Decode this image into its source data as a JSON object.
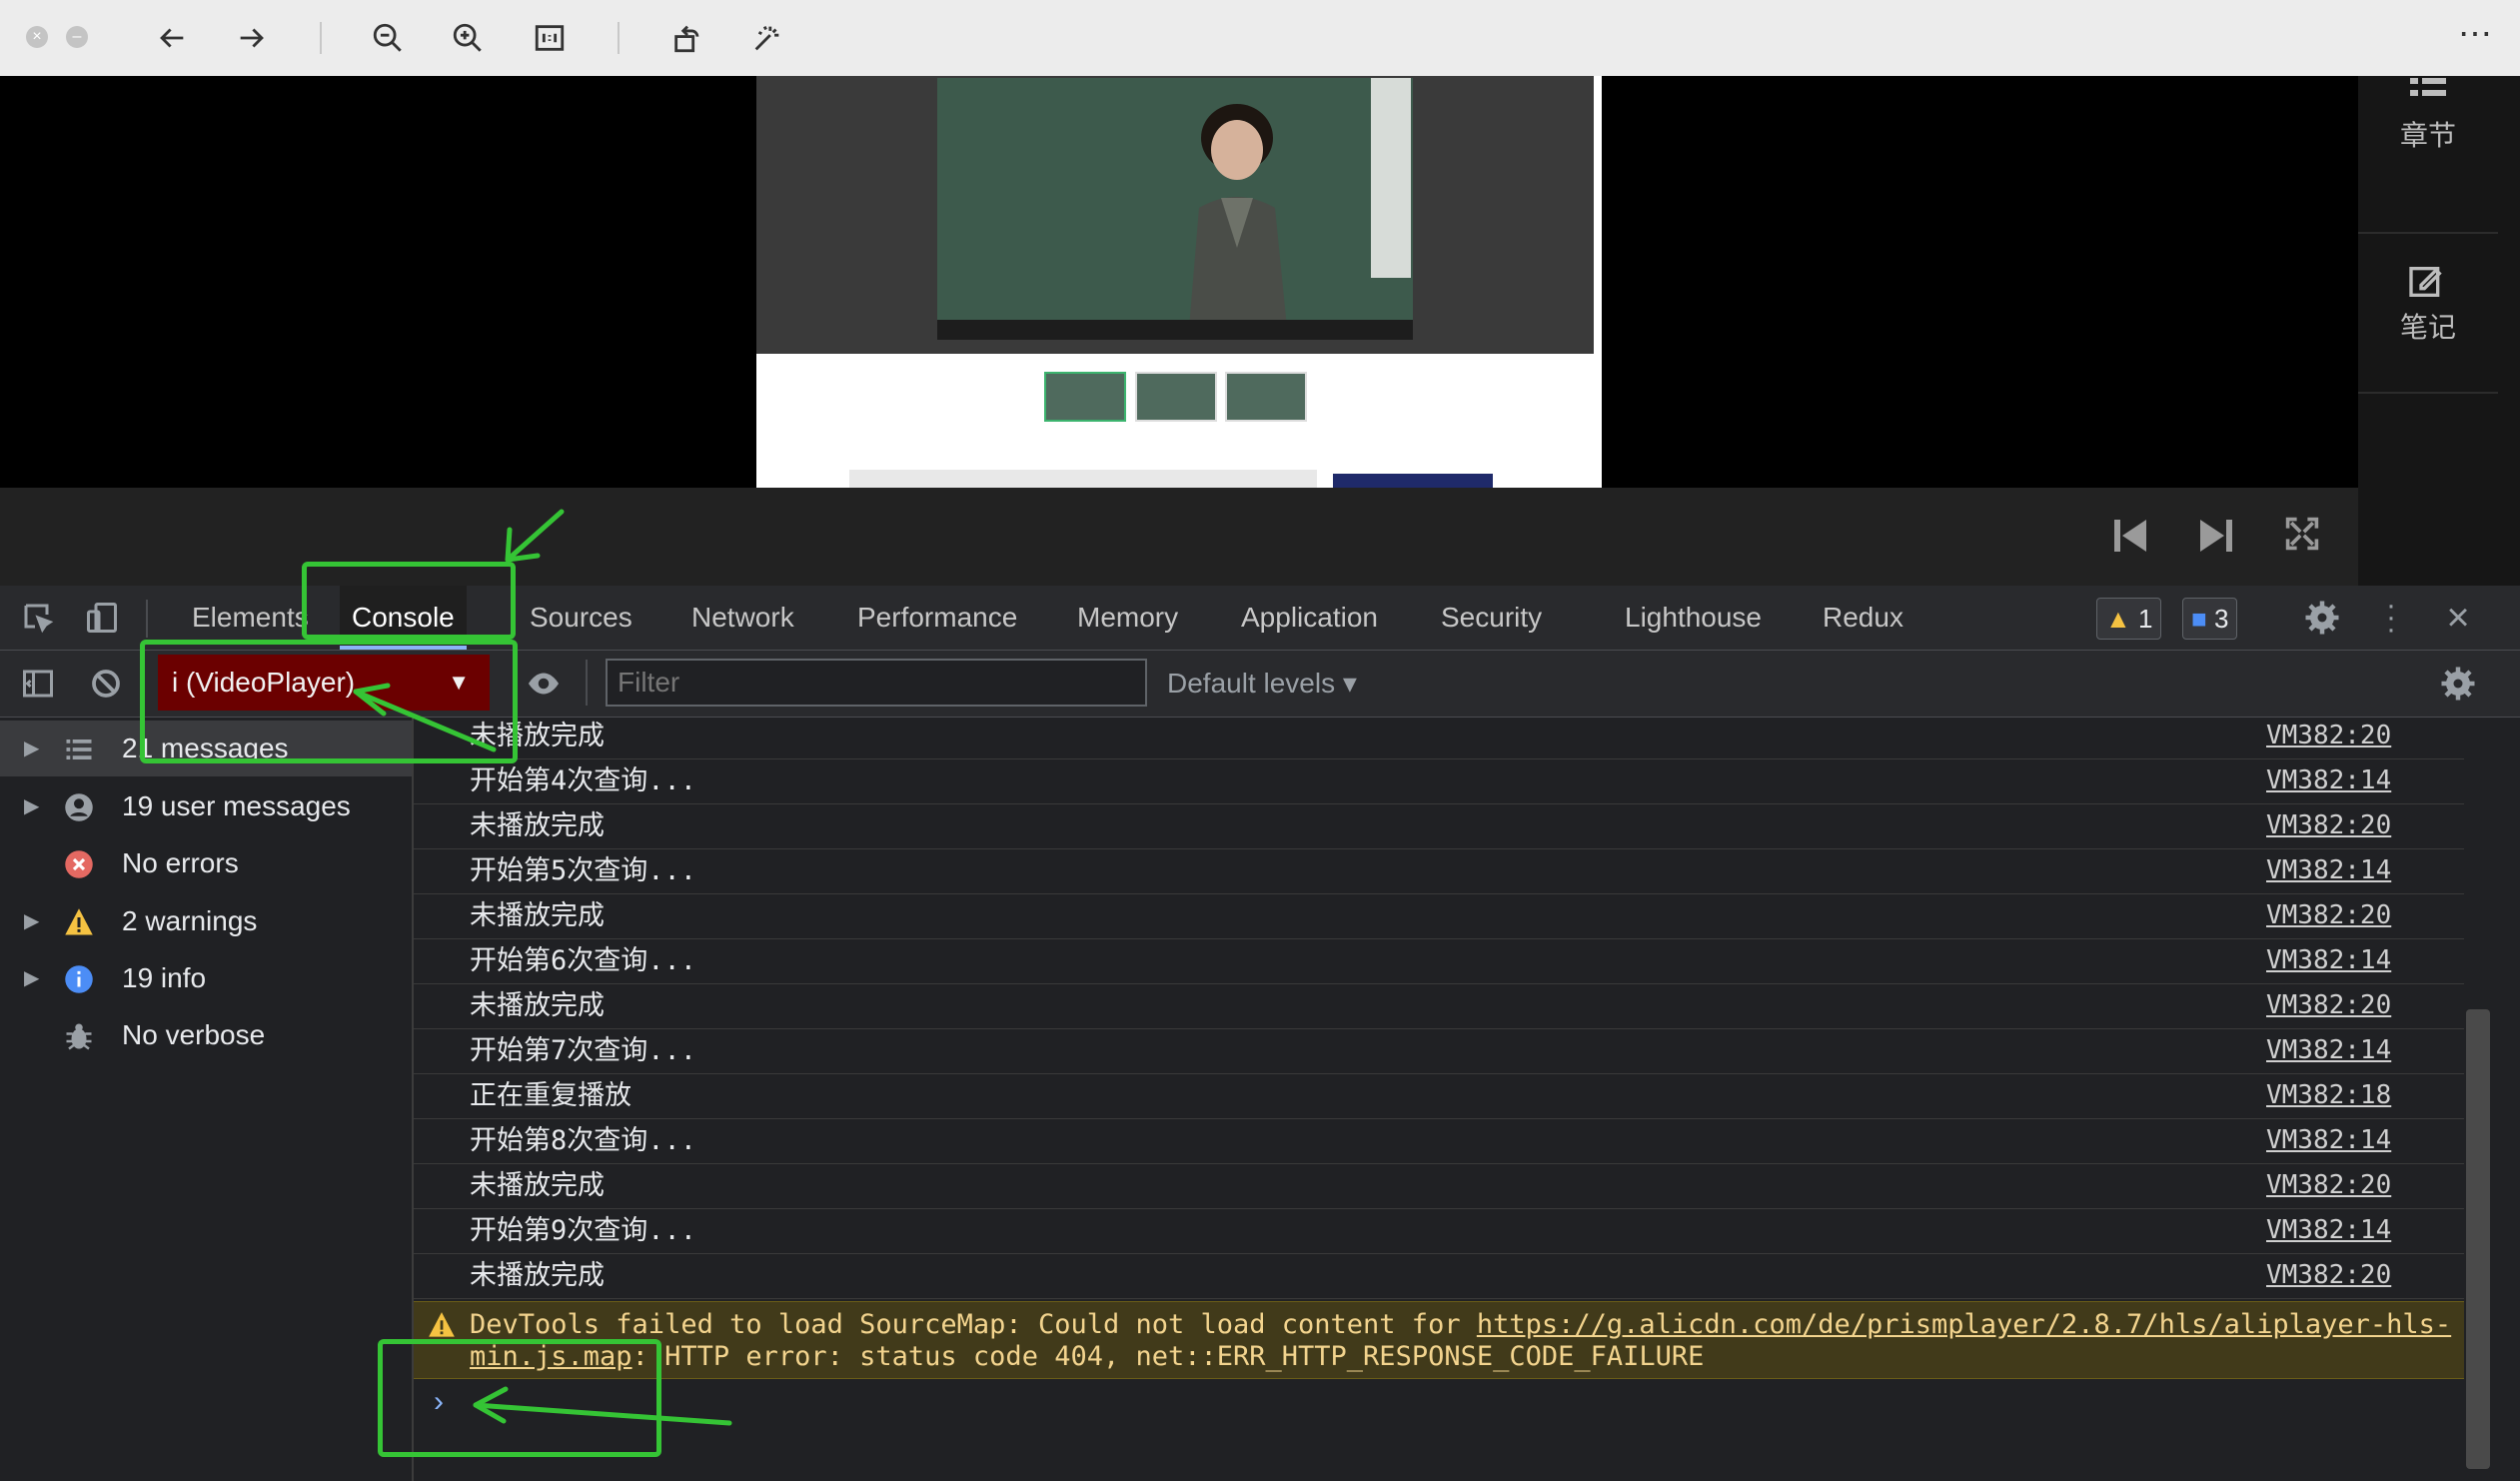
{
  "viewer_toolbar": {
    "more_label": "⋯"
  },
  "right_panel": {
    "chapters_label": "章节",
    "notes_label": "笔记"
  },
  "devtools": {
    "tabs": [
      "Elements",
      "Console",
      "Sources",
      "Network",
      "Performance",
      "Memory",
      "Application",
      "Security",
      "Lighthouse",
      "Redux"
    ],
    "active_tab": "Console",
    "warning_count": "1",
    "info_count": "3"
  },
  "console_toolbar": {
    "context": "i (VideoPlayer)",
    "filter_placeholder": "Filter",
    "levels": "Default levels ▾"
  },
  "sidebar": {
    "items": [
      {
        "label": "21 messages",
        "icon": "list-icon"
      },
      {
        "label": "19 user messages",
        "icon": "user-icon"
      },
      {
        "label": "No errors",
        "icon": "error-icon"
      },
      {
        "label": "2 warnings",
        "icon": "warning-icon"
      },
      {
        "label": "19 info",
        "icon": "info-icon"
      },
      {
        "label": "No verbose",
        "icon": "bug-icon"
      }
    ]
  },
  "logs": [
    {
      "message": "未播放完成",
      "source": "VM382:20"
    },
    {
      "message": "开始第4次查询...",
      "source": "VM382:14"
    },
    {
      "message": "未播放完成",
      "source": "VM382:20"
    },
    {
      "message": "开始第5次查询...",
      "source": "VM382:14"
    },
    {
      "message": "未播放完成",
      "source": "VM382:20"
    },
    {
      "message": "开始第6次查询...",
      "source": "VM382:14"
    },
    {
      "message": "未播放完成",
      "source": "VM382:20"
    },
    {
      "message": "开始第7次查询...",
      "source": "VM382:14"
    },
    {
      "message": "正在重复播放",
      "source": "VM382:18"
    },
    {
      "message": "开始第8次查询...",
      "source": "VM382:14"
    },
    {
      "message": "未播放完成",
      "source": "VM382:20"
    },
    {
      "message": "开始第9次查询...",
      "source": "VM382:14"
    },
    {
      "message": "未播放完成",
      "source": "VM382:20"
    }
  ],
  "warning": {
    "prefix": "DevTools failed to load SourceMap: Could not load content for ",
    "link_part1": "https://g.alicdn.com/de/prismplayer/2.8.7/hls/aliplayer-hls-",
    "link_part2": "min.js.map",
    "suffix": ": HTTP error: status code 404, net::ERR_HTTP_RESPONSE_CODE_FAILURE"
  },
  "prompt_symbol": "›",
  "colors": {
    "annotation_green": "#35c435",
    "context_red": "#6b0000",
    "warning_bg": "#413a1a"
  }
}
